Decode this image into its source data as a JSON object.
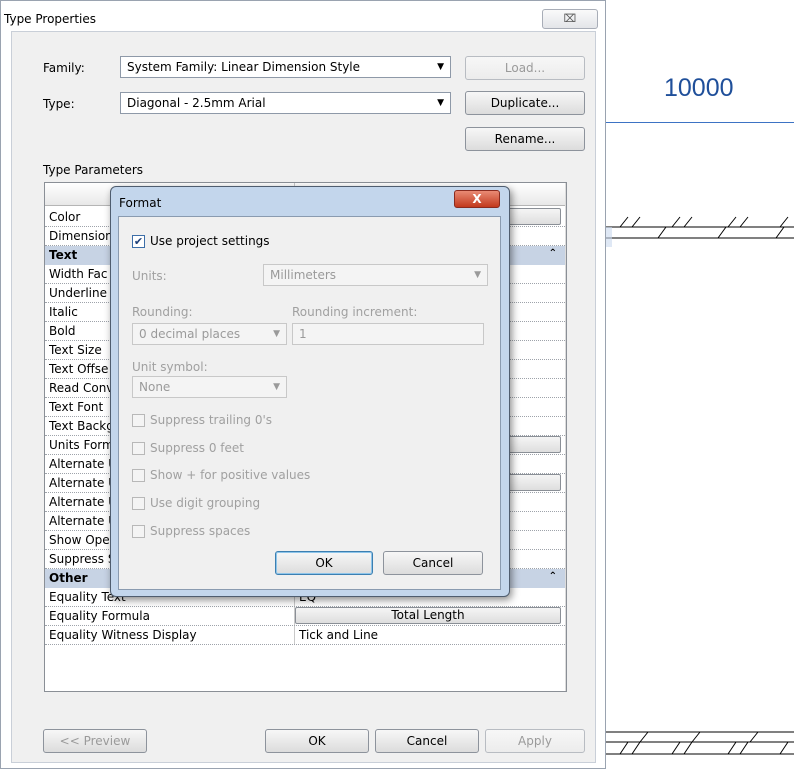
{
  "background": {
    "dimension_value": "10000"
  },
  "dialog": {
    "title": "Type Properties",
    "close_glyph": "⌧",
    "family_label": "Family:",
    "family_value": "System Family: Linear Dimension Style",
    "type_label": "Type:",
    "type_value": "Diagonal - 2.5mm Arial",
    "load_label": "Load...",
    "duplicate_label": "Duplicate...",
    "rename_label": "Rename...",
    "type_parameters_label": "Type Parameters",
    "preview_label": "<< Preview",
    "ok_label": "OK",
    "cancel_label": "Cancel",
    "apply_label": "Apply"
  },
  "grid": {
    "rows_top": [
      "Color",
      "Dimension"
    ],
    "group_text": "Text",
    "rows_text": [
      "Width Fac",
      "Underline",
      "Italic",
      "Bold",
      "Text Size",
      "Text Offse",
      "Read Conv",
      "Text Font",
      "Text Backg",
      "Units Form",
      "Alternate U",
      "Alternate U",
      "Alternate U",
      "Alternate U",
      "Show Ope",
      "Suppress S"
    ],
    "group_other": "Other",
    "other_rows": [
      {
        "name": "Equality Text",
        "value": "EQ"
      },
      {
        "name": "Equality Formula",
        "value": "Total Length"
      },
      {
        "name": "Equality Witness Display",
        "value": "Tick and Line"
      }
    ]
  },
  "format_dialog": {
    "title": "Format",
    "close_glyph": "X",
    "use_project_settings": "Use project settings",
    "use_project_settings_checked": true,
    "units_label": "Units:",
    "units_value": "Millimeters",
    "rounding_label": "Rounding:",
    "rounding_value": "0 decimal places",
    "rounding_increment_label": "Rounding increment:",
    "rounding_increment_value": "1",
    "unit_symbol_label": "Unit symbol:",
    "unit_symbol_value": "None",
    "options": [
      "Suppress trailing 0's",
      "Suppress 0 feet",
      "Show + for positive values",
      "Use digit grouping",
      "Suppress spaces"
    ],
    "ok_label": "OK",
    "cancel_label": "Cancel"
  }
}
